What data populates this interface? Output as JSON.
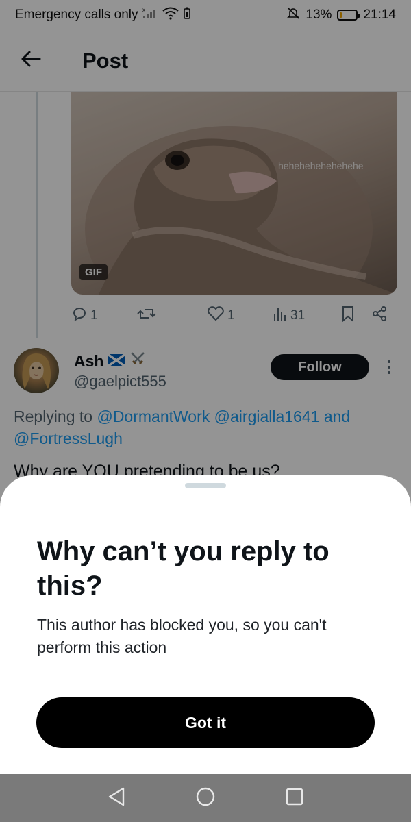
{
  "status_bar": {
    "carrier": "Emergency calls only",
    "battery": "13%",
    "battery_level": 0.13,
    "time": "21:14",
    "icons": [
      "signal-icon",
      "wifi-icon",
      "battery-saver-icon",
      "mute-icon",
      "battery-icon"
    ]
  },
  "header": {
    "title": "Post",
    "back_icon": "arrow-left-icon"
  },
  "tweet": {
    "media": {
      "type": "GIF",
      "badge": "GIF",
      "overlay_text": "hehehehehehehehe"
    },
    "actions": {
      "replies": "1",
      "retweets": "",
      "likes": "1",
      "views": "31"
    }
  },
  "reply": {
    "name": "Ash",
    "name_emojis": [
      "scotland-flag",
      "crossed-swords"
    ],
    "handle": "@gaelpict555",
    "follow_label": "Follow",
    "replying_prefix": "Replying to",
    "mention_1": "@DormantWork",
    "mention_2": "@airgialla1641",
    "mention_joiner": "and",
    "mention_3": "@FortressLugh",
    "text": "Why are YOU pretending to be us?"
  },
  "sheet": {
    "title": "Why can’t you reply to this?",
    "body": "This author has blocked you, so you can't perform this action",
    "button_label": "Got it"
  },
  "colors": {
    "accent_link": "#1d9bf0",
    "primary_button": "#000000",
    "follow_button": "#0f1419",
    "battery_fill": "#f0a500"
  }
}
